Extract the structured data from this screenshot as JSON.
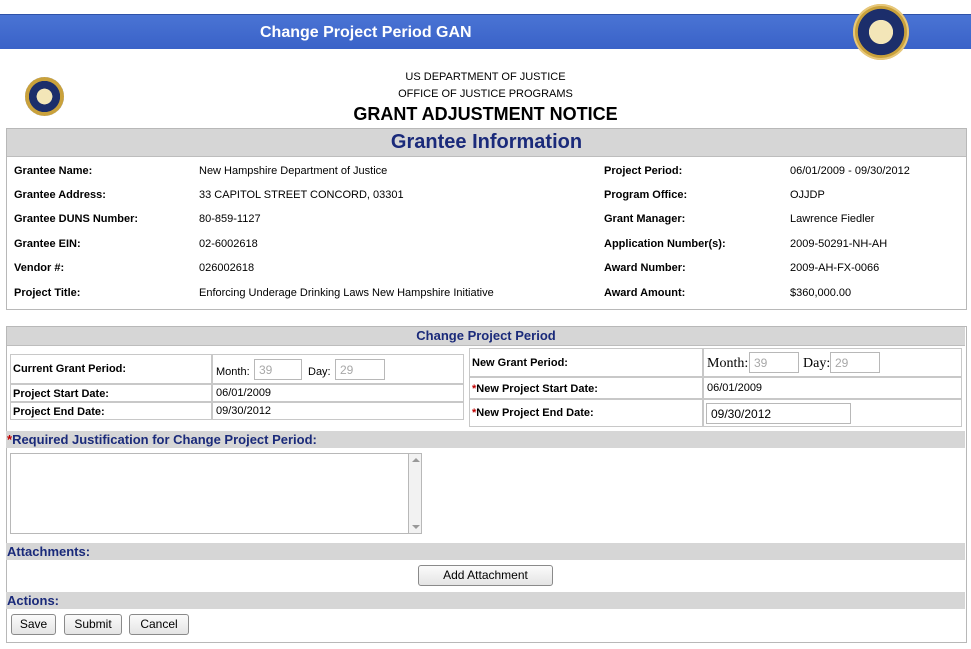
{
  "window": {
    "title": "Change Project Period GAN"
  },
  "header": {
    "line1": "US DEPARTMENT OF JUSTICE",
    "line2": "OFFICE OF JUSTICE PROGRAMS",
    "line3": "GRANT ADJUSTMENT NOTICE"
  },
  "grantee": {
    "section_title": "Grantee Information",
    "left": [
      {
        "label": "Grantee Name:",
        "value": "New Hampshire Department of Justice"
      },
      {
        "label": "Grantee Address:",
        "value": "33 CAPITOL STREET CONCORD, 03301"
      },
      {
        "label": "Grantee DUNS Number:",
        "value": "80-859-1127"
      },
      {
        "label": "Grantee EIN:",
        "value": "02-6002618"
      },
      {
        "label": "Vendor #:",
        "value": "026002618"
      },
      {
        "label": "Project Title:",
        "value": "Enforcing Underage Drinking Laws New Hampshire Initiative"
      }
    ],
    "right": [
      {
        "label": "Project Period:",
        "value": "06/01/2009 - 09/30/2012"
      },
      {
        "label": "Program Office:",
        "value": "OJJDP"
      },
      {
        "label": "Grant Manager:",
        "value": "Lawrence Fiedler"
      },
      {
        "label": "Application Number(s):",
        "value": "2009-50291-NH-AH"
      },
      {
        "label": "Award Number:",
        "value": "2009-AH-FX-0066"
      },
      {
        "label": "Award Amount:",
        "value": "$360,000.00"
      }
    ]
  },
  "change_period": {
    "section_title": "Change Project Period",
    "current": {
      "label": "Current Grant Period:",
      "month_label": "Month:",
      "month_value": "39",
      "day_label": "Day:",
      "day_value": "29",
      "start_label": "Project Start Date:",
      "start_value": "06/01/2009",
      "end_label": "Project End Date:",
      "end_value": "09/30/2012"
    },
    "new": {
      "label": "New Grant Period:",
      "month_label": "Month:",
      "month_value": "39",
      "day_label": "Day:",
      "day_value": "29",
      "required_mark": "*",
      "start_label": "New Project Start Date:",
      "start_value": "06/01/2009",
      "end_label": "New Project End Date:",
      "end_value": "09/30/2012"
    },
    "justification_label": "Required Justification for Change Project Period:",
    "justification_value": ""
  },
  "attachments": {
    "title": "Attachments:",
    "add_button": "Add Attachment"
  },
  "actions": {
    "title": "Actions:",
    "save": "Save",
    "submit": "Submit",
    "cancel": "Cancel"
  }
}
